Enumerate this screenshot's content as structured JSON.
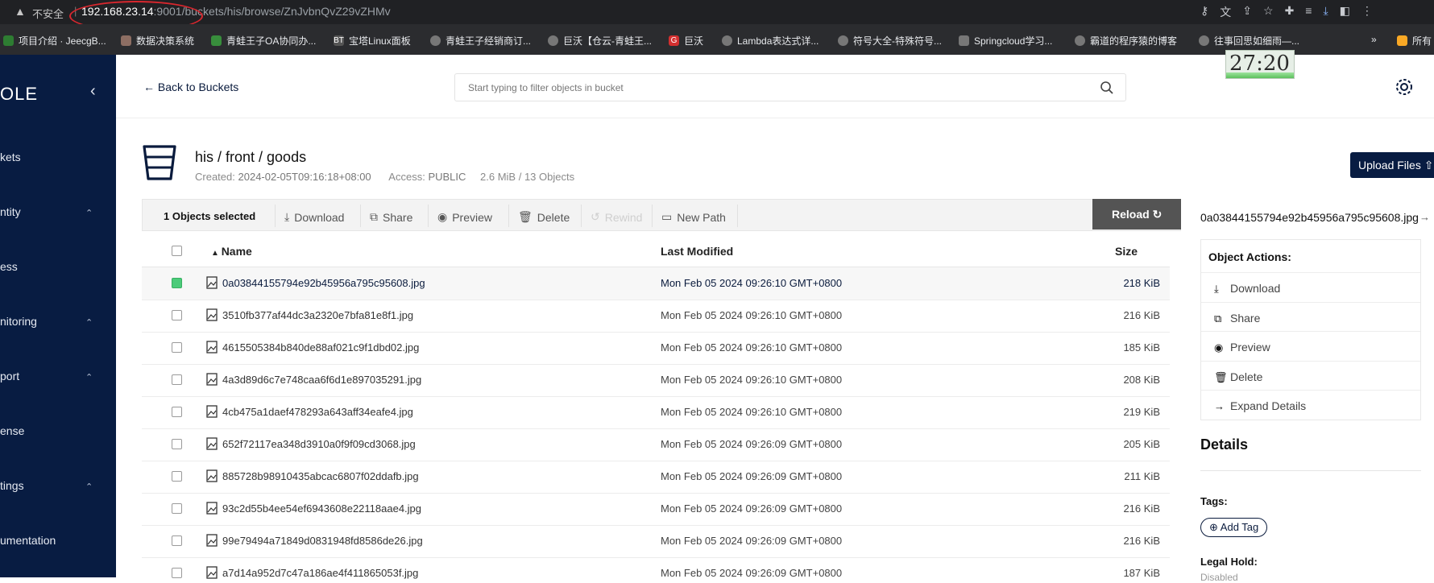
{
  "browser": {
    "insecure_label": "不安全",
    "url_host": "192.168.23.14",
    "url_rest": ":9001/buckets/his/browse/ZnJvbnQvZ29vZHMv",
    "bookmarks": [
      {
        "label": "项目介绍 · JeecgB...",
        "color": "#2e7d32"
      },
      {
        "label": "数据决策系统",
        "color": "#8d6e63"
      },
      {
        "label": "青蛙王子OA协同办...",
        "color": "#388e3c"
      },
      {
        "label": "宝塔Linux面板",
        "color": "#555555"
      },
      {
        "label": "青蛙王子经销商订...",
        "color": "#777777"
      },
      {
        "label": "巨沃【仓云-青蛙王...",
        "color": "#777777"
      },
      {
        "label": "巨沃",
        "color": "#d32f2f"
      },
      {
        "label": "Lambda表达式详...",
        "color": "#777777"
      },
      {
        "label": "符号大全-特殊符号...",
        "color": "#777777"
      },
      {
        "label": "Springcloud学习...",
        "color": "#777777"
      },
      {
        "label": "霸道的程序猿的博客",
        "color": "#777777"
      },
      {
        "label": "往事回思如细雨—...",
        "color": "#777777"
      },
      {
        "label": "所有",
        "color": "#f9a825"
      }
    ],
    "more": "»"
  },
  "sidebar": {
    "logo": "OLE",
    "items": [
      {
        "label": "kets",
        "chevron": false
      },
      {
        "label": "ntity",
        "chevron": true
      },
      {
        "label": "ess",
        "chevron": false
      },
      {
        "label": "nitoring",
        "chevron": true
      },
      {
        "label": "port",
        "chevron": true
      },
      {
        "label": "ense",
        "chevron": false
      },
      {
        "label": "tings",
        "chevron": true
      },
      {
        "label": "umentation",
        "chevron": false
      }
    ]
  },
  "header": {
    "back_label": "Back to Buckets",
    "search_placeholder": "Start typing to filter objects in bucket",
    "clock": "27:20"
  },
  "bucket": {
    "path": "his / front / goods",
    "created_label": "Created:",
    "created": "2024-02-05T09:16:18+08:00",
    "access_label": "Access:",
    "access": "PUBLIC",
    "summary": "2.6 MiB / 13 Objects",
    "upload_label": "Upload Files"
  },
  "toolbar": {
    "selected": "1 Objects selected",
    "download": "Download",
    "share": "Share",
    "preview": "Preview",
    "delete": "Delete",
    "rewind": "Rewind",
    "new_path": "New Path",
    "reload": "Reload"
  },
  "table": {
    "columns": {
      "name": "Name",
      "modified": "Last Modified",
      "size": "Size"
    },
    "rows": [
      {
        "name": "0a03844155794e92b45956a795c95608.jpg",
        "modified": "Mon Feb 05 2024 09:26:10 GMT+0800",
        "size": "218 KiB",
        "selected": true
      },
      {
        "name": "3510fb377af44dc3a2320e7bfa81e8f1.jpg",
        "modified": "Mon Feb 05 2024 09:26:10 GMT+0800",
        "size": "216 KiB",
        "selected": false
      },
      {
        "name": "4615505384b840de88af021c9f1dbd02.jpg",
        "modified": "Mon Feb 05 2024 09:26:10 GMT+0800",
        "size": "185 KiB",
        "selected": false
      },
      {
        "name": "4a3d89d6c7e748caa6f6d1e897035291.jpg",
        "modified": "Mon Feb 05 2024 09:26:10 GMT+0800",
        "size": "208 KiB",
        "selected": false
      },
      {
        "name": "4cb475a1daef478293a643aff34eafe4.jpg",
        "modified": "Mon Feb 05 2024 09:26:10 GMT+0800",
        "size": "219 KiB",
        "selected": false
      },
      {
        "name": "652f72117ea348d3910a0f9f09cd3068.jpg",
        "modified": "Mon Feb 05 2024 09:26:09 GMT+0800",
        "size": "205 KiB",
        "selected": false
      },
      {
        "name": "885728b98910435abcac6807f02ddafb.jpg",
        "modified": "Mon Feb 05 2024 09:26:09 GMT+0800",
        "size": "211 KiB",
        "selected": false
      },
      {
        "name": "93c2d55b4ee54ef6943608e22118aae4.jpg",
        "modified": "Mon Feb 05 2024 09:26:09 GMT+0800",
        "size": "216 KiB",
        "selected": false
      },
      {
        "name": "99e79494a71849d0831948fd8586de26.jpg",
        "modified": "Mon Feb 05 2024 09:26:09 GMT+0800",
        "size": "216 KiB",
        "selected": false
      },
      {
        "name": "a7d14a952d7c47a186ae4f411865053f.jpg",
        "modified": "Mon Feb 05 2024 09:26:09 GMT+0800",
        "size": "187 KiB",
        "selected": false
      }
    ]
  },
  "panel": {
    "object_name": "0a03844155794e92b45956a795c95608.jpg",
    "actions_title": "Object Actions:",
    "actions": [
      "Download",
      "Share",
      "Preview",
      "Delete",
      "Expand Details"
    ],
    "details_title": "Details",
    "tags_label": "Tags:",
    "add_tag": "Add Tag",
    "legal_hold_label": "Legal Hold:",
    "legal_hold_value": "Disabled"
  }
}
